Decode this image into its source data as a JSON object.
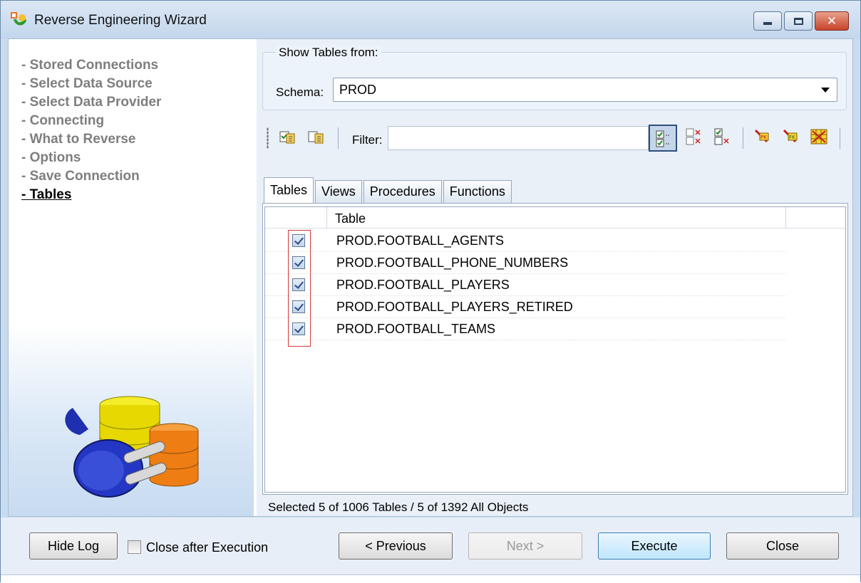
{
  "window": {
    "title": "Reverse Engineering Wizard",
    "controls": [
      "minimize",
      "maximize",
      "close"
    ]
  },
  "wizard_steps": [
    {
      "label": "- Stored Connections",
      "current": false
    },
    {
      "label": "- Select Data Source",
      "current": false
    },
    {
      "label": "- Select Data Provider",
      "current": false
    },
    {
      "label": "- Connecting",
      "current": false
    },
    {
      "label": "- What to Reverse",
      "current": false
    },
    {
      "label": "- Options",
      "current": false
    },
    {
      "label": "- Save Connection",
      "current": false
    },
    {
      "label": "- Tables",
      "current": true
    }
  ],
  "show_tables": {
    "legend": "Show Tables from:",
    "schema_label": "Schema:",
    "schema_value": "PROD"
  },
  "toolbar": {
    "filter_label": "Filter:",
    "filter_value": "",
    "icons": [
      "select-all-icon",
      "deselect-all-icon",
      "show-checked-icon",
      "show-unchecked-icon",
      "show-selected-icon",
      "pk-filter-icon",
      "fk-filter-icon",
      "grid-filter-icon"
    ],
    "pressed_icon": "show-checked-icon"
  },
  "tabs": [
    {
      "label": "Tables",
      "active": true
    },
    {
      "label": "Views",
      "active": false
    },
    {
      "label": "Procedures",
      "active": false
    },
    {
      "label": "Functions",
      "active": false
    }
  ],
  "grid": {
    "column_header": "Table",
    "rows": [
      {
        "name": "PROD.FOOTBALL_AGENTS",
        "checked": true
      },
      {
        "name": "PROD.FOOTBALL_PHONE_NUMBERS",
        "checked": true
      },
      {
        "name": "PROD.FOOTBALL_PLAYERS",
        "checked": true
      },
      {
        "name": "PROD.FOOTBALL_PLAYERS_RETIRED",
        "checked": true
      },
      {
        "name": "PROD.FOOTBALL_TEAMS",
        "checked": true
      }
    ]
  },
  "status_text": "Selected 5 of 1006 Tables / 5 of 1392 All Objects",
  "buttons": {
    "hide_log": "Hide Log",
    "close_after_execution": "Close after Execution",
    "close_after_execution_checked": false,
    "previous": "< Previous",
    "next": "Next >",
    "next_enabled": false,
    "execute": "Execute",
    "close": "Close"
  },
  "colors": {
    "accent_highlight": "#d43a3a",
    "title_bar": "#c9dcef",
    "close_button": "#c8432a"
  }
}
